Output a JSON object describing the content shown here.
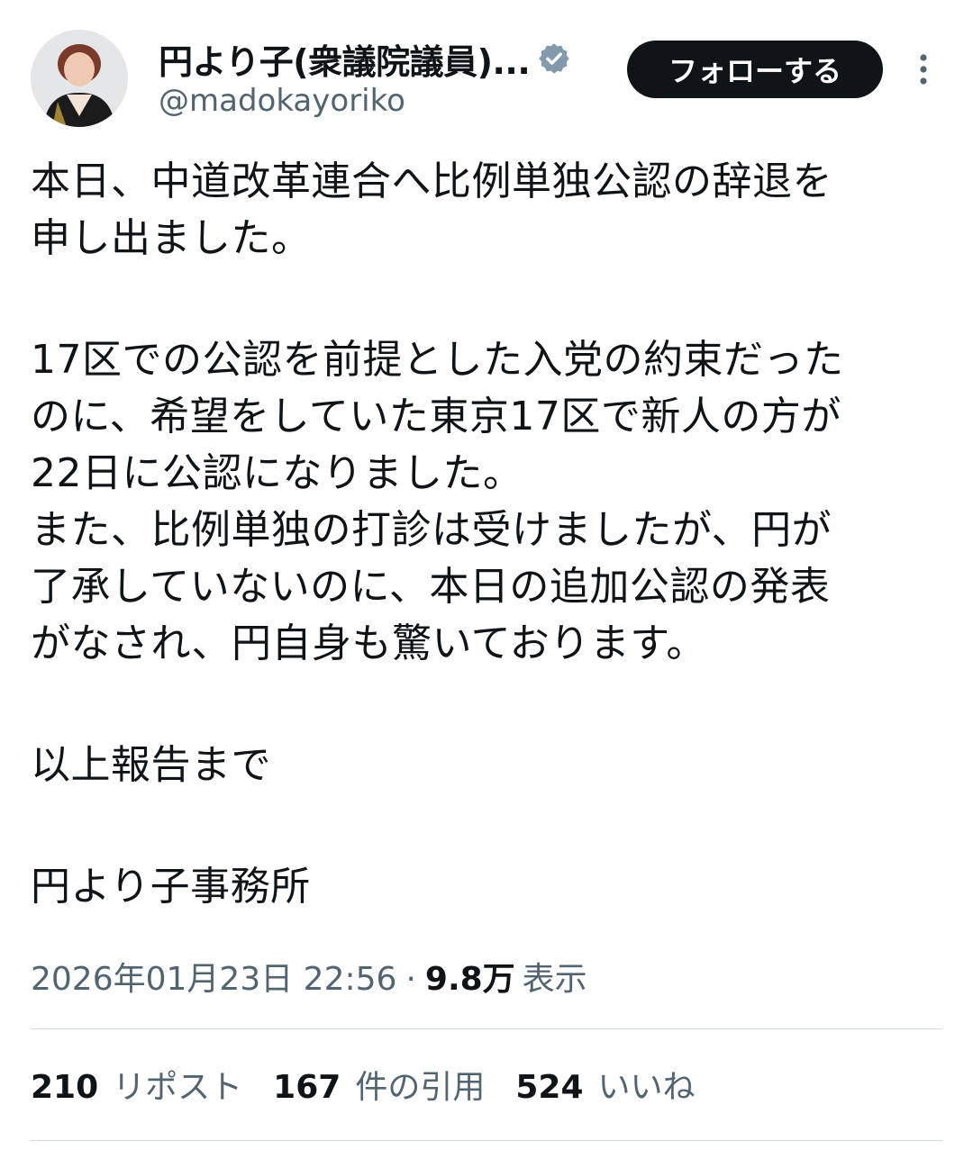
{
  "author": {
    "display_name": "円より子(衆議院議員)...",
    "handle": "@madokayoriko",
    "verified_icon": "verified-badge-icon",
    "verified_color": "#829aab"
  },
  "actions": {
    "follow_label": "フォローする",
    "more_icon": "more-vertical-icon"
  },
  "post": {
    "paragraphs": [
      "本日、中道改革連合へ比例単独公認の辞退を\n申し出ました。",
      "",
      "17区での公認を前提とした入党の約束だった\nのに、希望をしていた東京17区で新人の方が\n22日に公認になりました。\nまた、比例単独の打診は受けましたが、円が\n了承していないのに、本日の追加公認の発表\nがなされ、円自身も驚いております。",
      "",
      "以上報告まで",
      "",
      "円より子事務所"
    ]
  },
  "meta": {
    "timestamp": "2026年01月23日 22:56",
    "separator": "·",
    "views_count": "9.8万",
    "views_label": "表示"
  },
  "stats": {
    "reposts_count": "210",
    "reposts_label": "リポスト",
    "quotes_count": "167",
    "quotes_label": "件の引用",
    "likes_count": "524",
    "likes_label": "いいね"
  }
}
